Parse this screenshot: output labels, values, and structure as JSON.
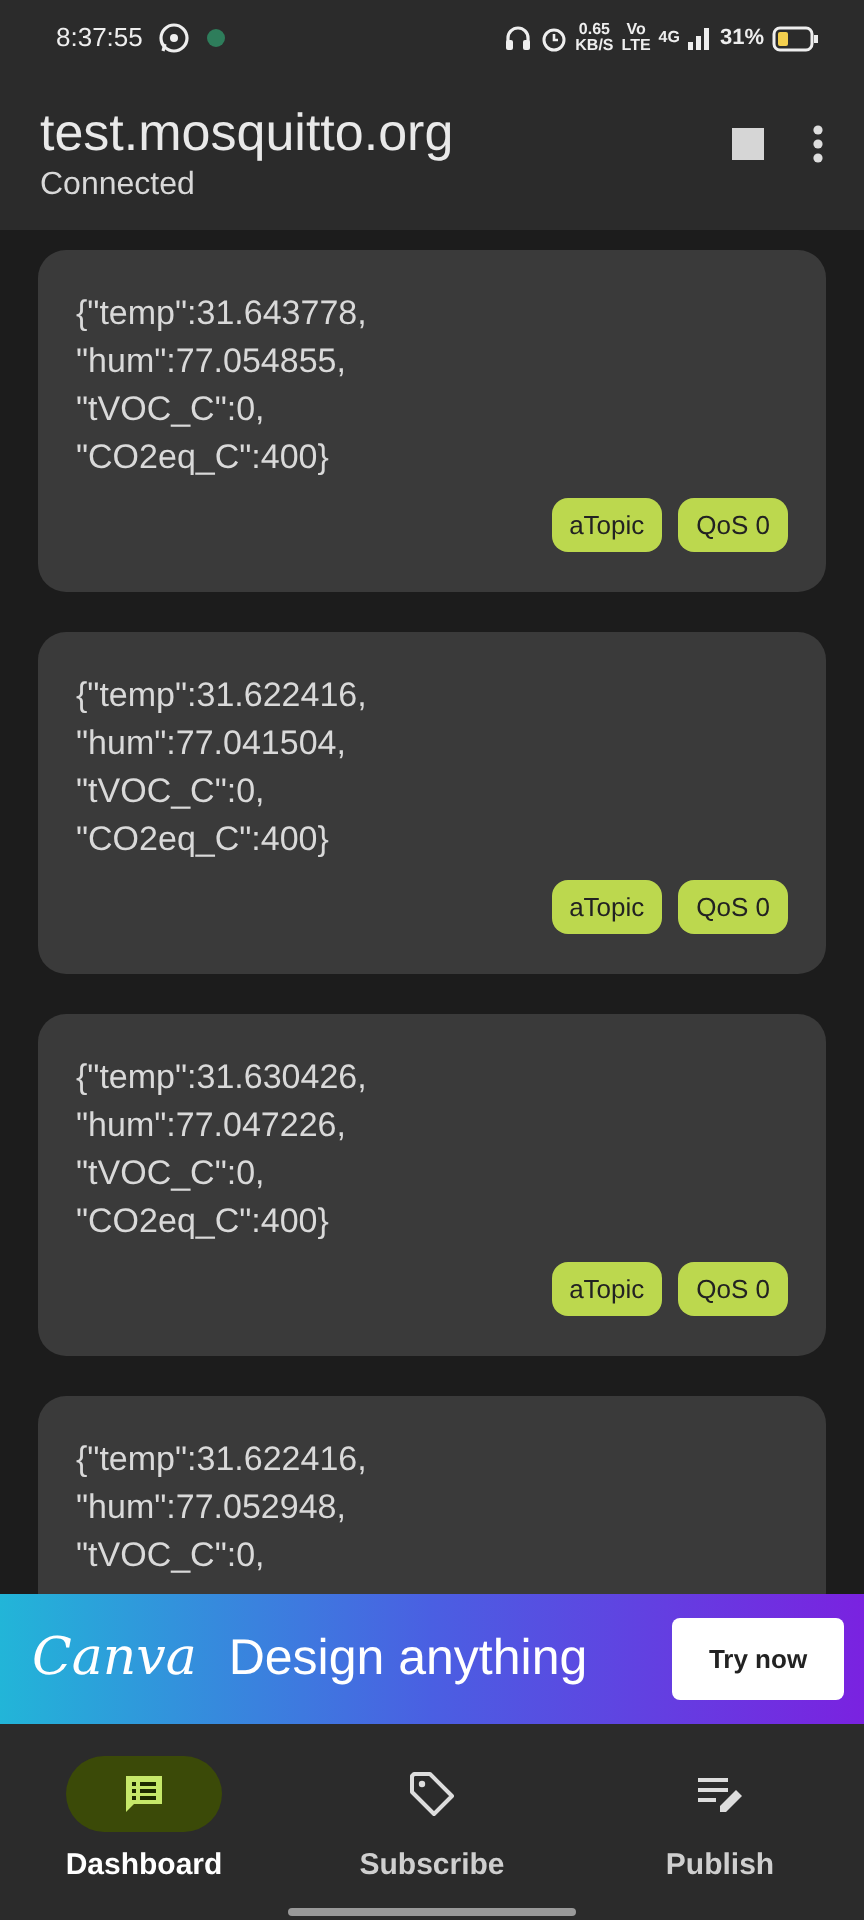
{
  "status_bar": {
    "time": "8:37:55",
    "speed_value": "0.65",
    "speed_unit": "KB/S",
    "volte_top": "Vo",
    "volte_bottom": "LTE",
    "network": "4G",
    "battery": "31%"
  },
  "app_bar": {
    "title": "test.mosquitto.org",
    "subtitle": "Connected"
  },
  "messages": [
    {
      "lines": [
        "{\"temp\":31.643778,",
        "\"hum\":77.054855,",
        "\"tVOC_C\":0,",
        "\"CO2eq_C\":400}"
      ],
      "chips": [
        "aTopic",
        "QoS 0"
      ]
    },
    {
      "lines": [
        "{\"temp\":31.622416,",
        "\"hum\":77.041504,",
        "\"tVOC_C\":0,",
        "\"CO2eq_C\":400}"
      ],
      "chips": [
        "aTopic",
        "QoS 0"
      ]
    },
    {
      "lines": [
        "{\"temp\":31.630426,",
        "\"hum\":77.047226,",
        "\"tVOC_C\":0,",
        "\"CO2eq_C\":400}"
      ],
      "chips": [
        "aTopic",
        "QoS 0"
      ]
    },
    {
      "lines": [
        "{\"temp\":31.622416,",
        "\"hum\":77.052948,",
        "\"tVOC_C\":0,"
      ]
    }
  ],
  "ad_banner": {
    "brand": "Canva",
    "headline": "Design anything",
    "button": "Try now"
  },
  "bottom_nav": [
    {
      "label": "Dashboard",
      "kind": "dashboard",
      "selected": true
    },
    {
      "label": "Subscribe",
      "kind": "subscribe",
      "selected": false
    },
    {
      "label": "Publish",
      "kind": "publish",
      "selected": false
    }
  ]
}
